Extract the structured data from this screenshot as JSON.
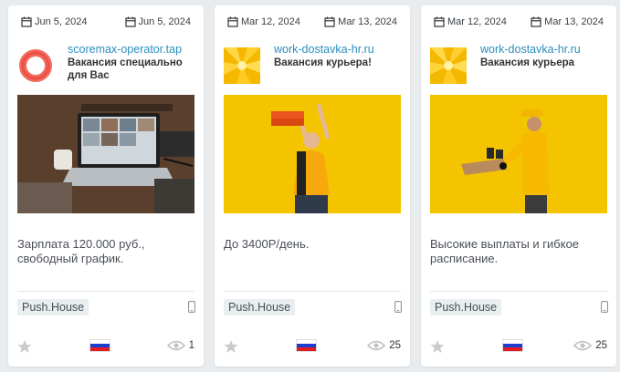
{
  "cards": [
    {
      "date_start": "Jun 5, 2024",
      "date_end": "Jun 5, 2024",
      "source": "scoremax-operator.tap",
      "title": "Вакансия специально для Вас",
      "text": "Зарплата 120.000 руб., свободный график.",
      "network": "Push.House",
      "views": "1",
      "image": "laptop-video-call",
      "logo": "red-ring-logo",
      "device": "mobile",
      "country_flag": "russia"
    },
    {
      "date_start": "Mar 12, 2024",
      "date_end": "Mar 13, 2024",
      "source": "work-dostavka-hr.ru",
      "title": "Вакансия курьера!",
      "text": "До 3400Р/день.",
      "network": "Push.House",
      "views": "25",
      "image": "courier-with-pizza-boxes",
      "logo": "yellow-burst-logo",
      "device": "mobile",
      "country_flag": "russia"
    },
    {
      "date_start": "Mar 12, 2024",
      "date_end": "Mar 13, 2024",
      "source": "work-dostavka-hr.ru",
      "title": "Вакансия курьера",
      "text": "Высокие выплаты и гибкое расписание.",
      "network": "Push.House",
      "views": "25",
      "image": "courier-with-food-tray",
      "logo": "yellow-burst-logo",
      "device": "mobile",
      "country_flag": "russia"
    }
  ],
  "colors": {
    "source_link": "#2a8ebf",
    "page_bg": "#e9ecef",
    "image_yellow": "#f5c400"
  }
}
